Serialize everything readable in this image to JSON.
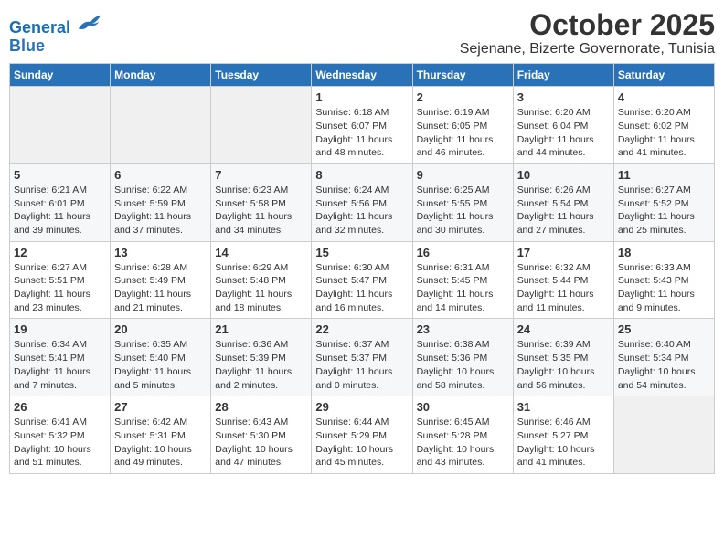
{
  "header": {
    "logo_line1": "General",
    "logo_line2": "Blue",
    "title": "October 2025",
    "subtitle": "Sejenane, Bizerte Governorate, Tunisia"
  },
  "weekdays": [
    "Sunday",
    "Monday",
    "Tuesday",
    "Wednesday",
    "Thursday",
    "Friday",
    "Saturday"
  ],
  "weeks": [
    [
      {
        "day": "",
        "sunrise": "",
        "sunset": "",
        "daylight": ""
      },
      {
        "day": "",
        "sunrise": "",
        "sunset": "",
        "daylight": ""
      },
      {
        "day": "",
        "sunrise": "",
        "sunset": "",
        "daylight": ""
      },
      {
        "day": "1",
        "sunrise": "Sunrise: 6:18 AM",
        "sunset": "Sunset: 6:07 PM",
        "daylight": "Daylight: 11 hours and 48 minutes."
      },
      {
        "day": "2",
        "sunrise": "Sunrise: 6:19 AM",
        "sunset": "Sunset: 6:05 PM",
        "daylight": "Daylight: 11 hours and 46 minutes."
      },
      {
        "day": "3",
        "sunrise": "Sunrise: 6:20 AM",
        "sunset": "Sunset: 6:04 PM",
        "daylight": "Daylight: 11 hours and 44 minutes."
      },
      {
        "day": "4",
        "sunrise": "Sunrise: 6:20 AM",
        "sunset": "Sunset: 6:02 PM",
        "daylight": "Daylight: 11 hours and 41 minutes."
      }
    ],
    [
      {
        "day": "5",
        "sunrise": "Sunrise: 6:21 AM",
        "sunset": "Sunset: 6:01 PM",
        "daylight": "Daylight: 11 hours and 39 minutes."
      },
      {
        "day": "6",
        "sunrise": "Sunrise: 6:22 AM",
        "sunset": "Sunset: 5:59 PM",
        "daylight": "Daylight: 11 hours and 37 minutes."
      },
      {
        "day": "7",
        "sunrise": "Sunrise: 6:23 AM",
        "sunset": "Sunset: 5:58 PM",
        "daylight": "Daylight: 11 hours and 34 minutes."
      },
      {
        "day": "8",
        "sunrise": "Sunrise: 6:24 AM",
        "sunset": "Sunset: 5:56 PM",
        "daylight": "Daylight: 11 hours and 32 minutes."
      },
      {
        "day": "9",
        "sunrise": "Sunrise: 6:25 AM",
        "sunset": "Sunset: 5:55 PM",
        "daylight": "Daylight: 11 hours and 30 minutes."
      },
      {
        "day": "10",
        "sunrise": "Sunrise: 6:26 AM",
        "sunset": "Sunset: 5:54 PM",
        "daylight": "Daylight: 11 hours and 27 minutes."
      },
      {
        "day": "11",
        "sunrise": "Sunrise: 6:27 AM",
        "sunset": "Sunset: 5:52 PM",
        "daylight": "Daylight: 11 hours and 25 minutes."
      }
    ],
    [
      {
        "day": "12",
        "sunrise": "Sunrise: 6:27 AM",
        "sunset": "Sunset: 5:51 PM",
        "daylight": "Daylight: 11 hours and 23 minutes."
      },
      {
        "day": "13",
        "sunrise": "Sunrise: 6:28 AM",
        "sunset": "Sunset: 5:49 PM",
        "daylight": "Daylight: 11 hours and 21 minutes."
      },
      {
        "day": "14",
        "sunrise": "Sunrise: 6:29 AM",
        "sunset": "Sunset: 5:48 PM",
        "daylight": "Daylight: 11 hours and 18 minutes."
      },
      {
        "day": "15",
        "sunrise": "Sunrise: 6:30 AM",
        "sunset": "Sunset: 5:47 PM",
        "daylight": "Daylight: 11 hours and 16 minutes."
      },
      {
        "day": "16",
        "sunrise": "Sunrise: 6:31 AM",
        "sunset": "Sunset: 5:45 PM",
        "daylight": "Daylight: 11 hours and 14 minutes."
      },
      {
        "day": "17",
        "sunrise": "Sunrise: 6:32 AM",
        "sunset": "Sunset: 5:44 PM",
        "daylight": "Daylight: 11 hours and 11 minutes."
      },
      {
        "day": "18",
        "sunrise": "Sunrise: 6:33 AM",
        "sunset": "Sunset: 5:43 PM",
        "daylight": "Daylight: 11 hours and 9 minutes."
      }
    ],
    [
      {
        "day": "19",
        "sunrise": "Sunrise: 6:34 AM",
        "sunset": "Sunset: 5:41 PM",
        "daylight": "Daylight: 11 hours and 7 minutes."
      },
      {
        "day": "20",
        "sunrise": "Sunrise: 6:35 AM",
        "sunset": "Sunset: 5:40 PM",
        "daylight": "Daylight: 11 hours and 5 minutes."
      },
      {
        "day": "21",
        "sunrise": "Sunrise: 6:36 AM",
        "sunset": "Sunset: 5:39 PM",
        "daylight": "Daylight: 11 hours and 2 minutes."
      },
      {
        "day": "22",
        "sunrise": "Sunrise: 6:37 AM",
        "sunset": "Sunset: 5:37 PM",
        "daylight": "Daylight: 11 hours and 0 minutes."
      },
      {
        "day": "23",
        "sunrise": "Sunrise: 6:38 AM",
        "sunset": "Sunset: 5:36 PM",
        "daylight": "Daylight: 10 hours and 58 minutes."
      },
      {
        "day": "24",
        "sunrise": "Sunrise: 6:39 AM",
        "sunset": "Sunset: 5:35 PM",
        "daylight": "Daylight: 10 hours and 56 minutes."
      },
      {
        "day": "25",
        "sunrise": "Sunrise: 6:40 AM",
        "sunset": "Sunset: 5:34 PM",
        "daylight": "Daylight: 10 hours and 54 minutes."
      }
    ],
    [
      {
        "day": "26",
        "sunrise": "Sunrise: 6:41 AM",
        "sunset": "Sunset: 5:32 PM",
        "daylight": "Daylight: 10 hours and 51 minutes."
      },
      {
        "day": "27",
        "sunrise": "Sunrise: 6:42 AM",
        "sunset": "Sunset: 5:31 PM",
        "daylight": "Daylight: 10 hours and 49 minutes."
      },
      {
        "day": "28",
        "sunrise": "Sunrise: 6:43 AM",
        "sunset": "Sunset: 5:30 PM",
        "daylight": "Daylight: 10 hours and 47 minutes."
      },
      {
        "day": "29",
        "sunrise": "Sunrise: 6:44 AM",
        "sunset": "Sunset: 5:29 PM",
        "daylight": "Daylight: 10 hours and 45 minutes."
      },
      {
        "day": "30",
        "sunrise": "Sunrise: 6:45 AM",
        "sunset": "Sunset: 5:28 PM",
        "daylight": "Daylight: 10 hours and 43 minutes."
      },
      {
        "day": "31",
        "sunrise": "Sunrise: 6:46 AM",
        "sunset": "Sunset: 5:27 PM",
        "daylight": "Daylight: 10 hours and 41 minutes."
      },
      {
        "day": "",
        "sunrise": "",
        "sunset": "",
        "daylight": ""
      }
    ]
  ]
}
